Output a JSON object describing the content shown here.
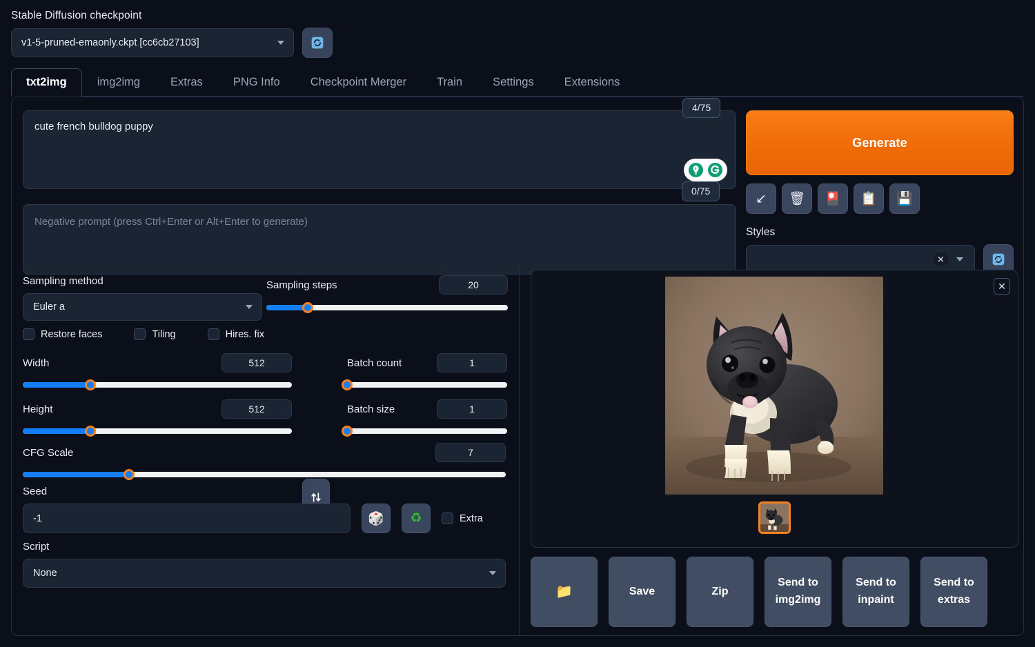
{
  "checkpoint": {
    "label": "Stable Diffusion checkpoint",
    "value": "v1-5-pruned-emaonly.ckpt [cc6cb27103]",
    "refresh_icon": "refresh-icon"
  },
  "tabs": [
    {
      "label": "txt2img",
      "active": true
    },
    {
      "label": "img2img",
      "active": false
    },
    {
      "label": "Extras",
      "active": false
    },
    {
      "label": "PNG Info",
      "active": false
    },
    {
      "label": "Checkpoint Merger",
      "active": false
    },
    {
      "label": "Train",
      "active": false
    },
    {
      "label": "Settings",
      "active": false
    },
    {
      "label": "Extensions",
      "active": false
    }
  ],
  "prompt": {
    "value": "cute french bulldog puppy",
    "token_count": "4/75",
    "pill_icons": [
      "lightbulb-icon",
      "restore-progress-icon"
    ]
  },
  "negative_prompt": {
    "placeholder": "Negative prompt (press Ctrl+Enter or Alt+Enter to generate)",
    "value": "",
    "token_count": "0/75"
  },
  "generate": {
    "label": "Generate",
    "color": "#ef6c08",
    "tools": [
      {
        "name": "read-generation-params-button",
        "glyph": "↙"
      },
      {
        "name": "clear-prompt-button",
        "glyph": "🗑"
      },
      {
        "name": "apply-style-button",
        "glyph": "🎴"
      },
      {
        "name": "paste-clipboard-button",
        "glyph": "📋"
      },
      {
        "name": "save-style-button",
        "glyph": "💾"
      }
    ]
  },
  "styles": {
    "label": "Styles",
    "value": "",
    "clear_glyph": "✕",
    "refresh_icon": "refresh-icon"
  },
  "sampling": {
    "method_label": "Sampling method",
    "method_value": "Euler a",
    "steps_label": "Sampling steps",
    "steps_value": "20",
    "steps_percent": 17
  },
  "toggles": [
    {
      "label": "Restore faces",
      "checked": false
    },
    {
      "label": "Tiling",
      "checked": false
    },
    {
      "label": "Hires. fix",
      "checked": false
    }
  ],
  "dimensions": {
    "width_label": "Width",
    "width_value": "512",
    "width_percent": 25,
    "height_label": "Height",
    "height_value": "512",
    "height_percent": 25,
    "swap_icon": "swap-vertical-icon"
  },
  "batch": {
    "count_label": "Batch count",
    "count_value": "1",
    "count_percent": 0,
    "size_label": "Batch size",
    "size_value": "1",
    "size_percent": 0
  },
  "cfg": {
    "label": "CFG Scale",
    "value": "7",
    "percent": 22
  },
  "seed": {
    "label": "Seed",
    "value": "-1",
    "dice_icon": "🎲",
    "recycle_icon": "♻",
    "extra_label": "Extra",
    "extra_checked": false
  },
  "script": {
    "label": "Script",
    "value": "None"
  },
  "result": {
    "close_glyph": "✕",
    "image_alt": "generated-french-bulldog-puppy",
    "thumbnail_alt": "gallery-thumbnail-french-bulldog-puppy",
    "actions": [
      {
        "name": "open-folder-button",
        "label": "📁",
        "icon_only": true
      },
      {
        "name": "save-button",
        "label": "Save",
        "icon_only": false
      },
      {
        "name": "zip-button",
        "label": "Zip",
        "icon_only": false
      },
      {
        "name": "send-to-img2img-button",
        "label": "Send to img2img",
        "icon_only": false
      },
      {
        "name": "send-to-inpaint-button",
        "label": "Send to inpaint",
        "icon_only": false
      },
      {
        "name": "send-to-extras-button",
        "label": "Send to extras",
        "icon_only": false
      }
    ]
  }
}
